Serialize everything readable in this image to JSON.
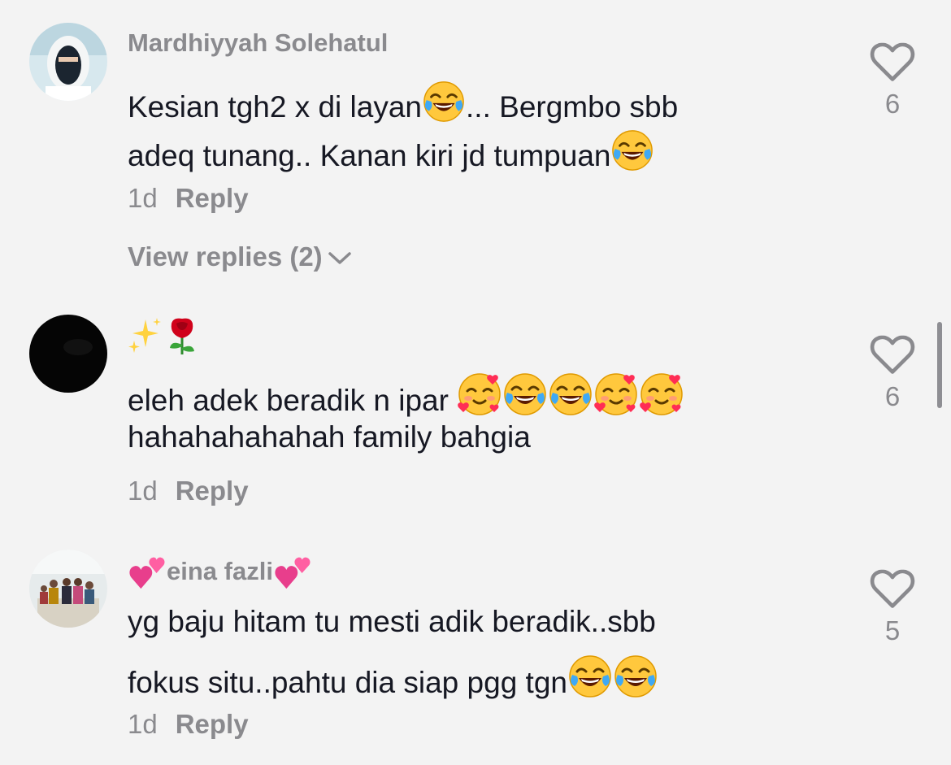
{
  "comments": [
    {
      "username": "Mardhiyyah Solehatul",
      "line1_a": "Kesian tgh2 x di layan",
      "line1_b": "... Bergmbo sbb",
      "line2": "adeq tunang.. Kanan kiri jd tumpuan",
      "time": "1d",
      "reply_label": "Reply",
      "view_replies": "View replies (2)",
      "likes": "6",
      "avatar_icon": "avatar-hijab-photo"
    },
    {
      "username_emoji": [
        "sparkles-emoji",
        "rose-emoji"
      ],
      "line1": "eleh adek beradik n ipar ",
      "line2": "hahahahahahah family bahgia",
      "time": "1d",
      "reply_label": "Reply",
      "likes": "6",
      "avatar_icon": "avatar-dark-photo"
    },
    {
      "username": "eina fazli",
      "line1": "yg baju hitam tu mesti adik beradik..sbb",
      "line2": "fokus situ..pahtu dia siap pgg tgn",
      "time": "1d",
      "reply_label": "Reply",
      "likes": "5",
      "avatar_icon": "avatar-family-photo"
    }
  ],
  "colors": {
    "background": "#f3f3f3",
    "text": "#161823",
    "secondary": "#8a8a8e"
  }
}
